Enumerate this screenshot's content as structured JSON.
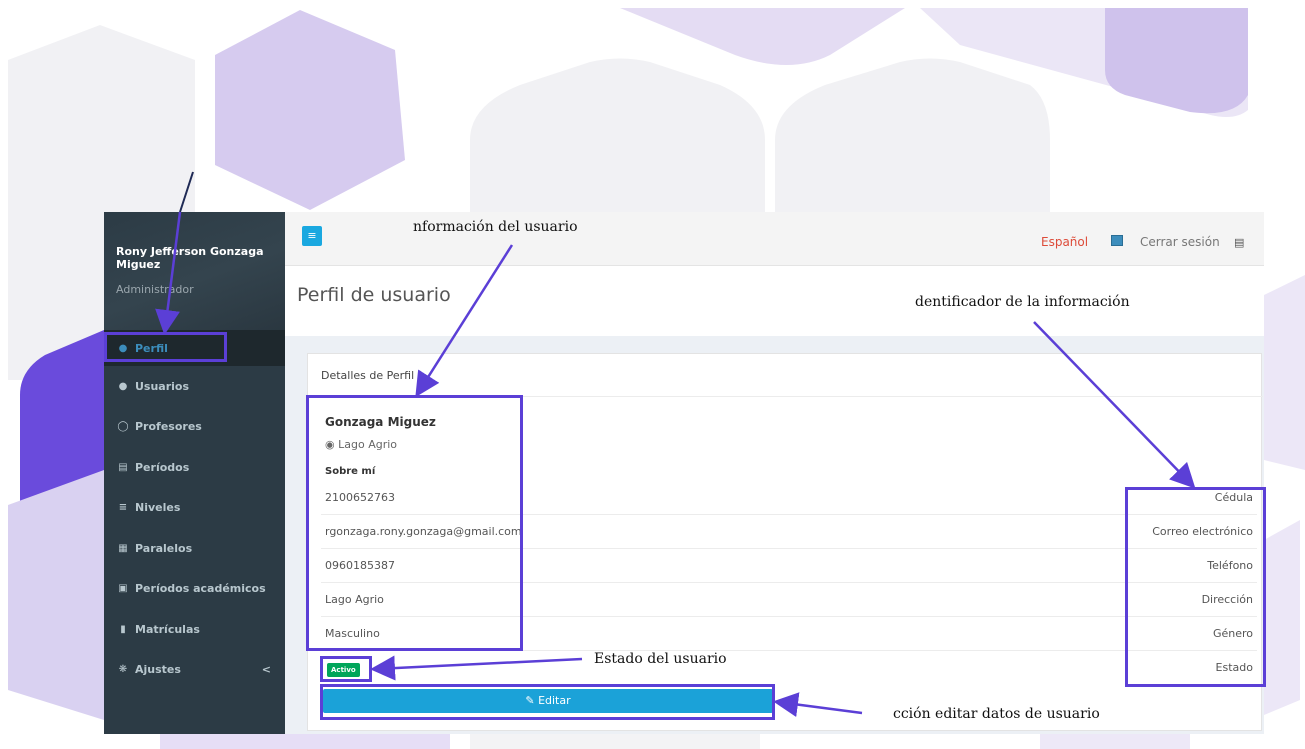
{
  "sidebar": {
    "user_name": "Rony Jefferson Gonzaga Miguez",
    "user_role": "Administrador",
    "items": [
      {
        "label": "Perfil",
        "icon": "user-icon",
        "active": true
      },
      {
        "label": "Usuarios",
        "icon": "users-icon"
      },
      {
        "label": "Profesores",
        "icon": "user-circle-icon"
      },
      {
        "label": "Períodos",
        "icon": "list-alt-icon"
      },
      {
        "label": "Niveles",
        "icon": "list-ol-icon"
      },
      {
        "label": "Paralelos",
        "icon": "th-list-icon"
      },
      {
        "label": "Períodos académicos",
        "icon": "calendar-icon"
      },
      {
        "label": "Matrículas",
        "icon": "book-icon"
      },
      {
        "label": "Ajustes",
        "icon": "cog-icon",
        "chevron": "<"
      }
    ]
  },
  "topbar": {
    "menu_glyph": "≡",
    "language": "Español",
    "logout": "Cerrar sesión"
  },
  "page": {
    "title": "Perfil de usuario"
  },
  "card": {
    "header": "Detalles de Perfil",
    "name": "Gonzaga Miguez",
    "location": "Lago Agrio",
    "about_label": "Sobre mí",
    "rows": [
      {
        "value": "2100652763",
        "key": "Cédula"
      },
      {
        "value": "rgonzaga.rony.gonzaga@gmail.com",
        "key": "Correo electrónico"
      },
      {
        "value": "0960185387",
        "key": "Teléfono"
      },
      {
        "value": "Lago Agrio",
        "key": "Dirección"
      },
      {
        "value": "Masculino",
        "key": "Género"
      },
      {
        "value": "",
        "key": "Estado"
      }
    ],
    "status_badge": "Activo",
    "edit_button": "Editar"
  },
  "annotations": {
    "user_info": "nformación del usuario",
    "info_identifier": "dentificador de la información",
    "user_status": "Estado del usuario",
    "edit_action": "cción editar datos de usuario"
  },
  "colors": {
    "annotation": "#5b3fd6",
    "sidebar_bg": "#2c3b45",
    "accent": "#1ba2d8",
    "status_green": "#00a65a",
    "language_red": "#dd4b39"
  }
}
